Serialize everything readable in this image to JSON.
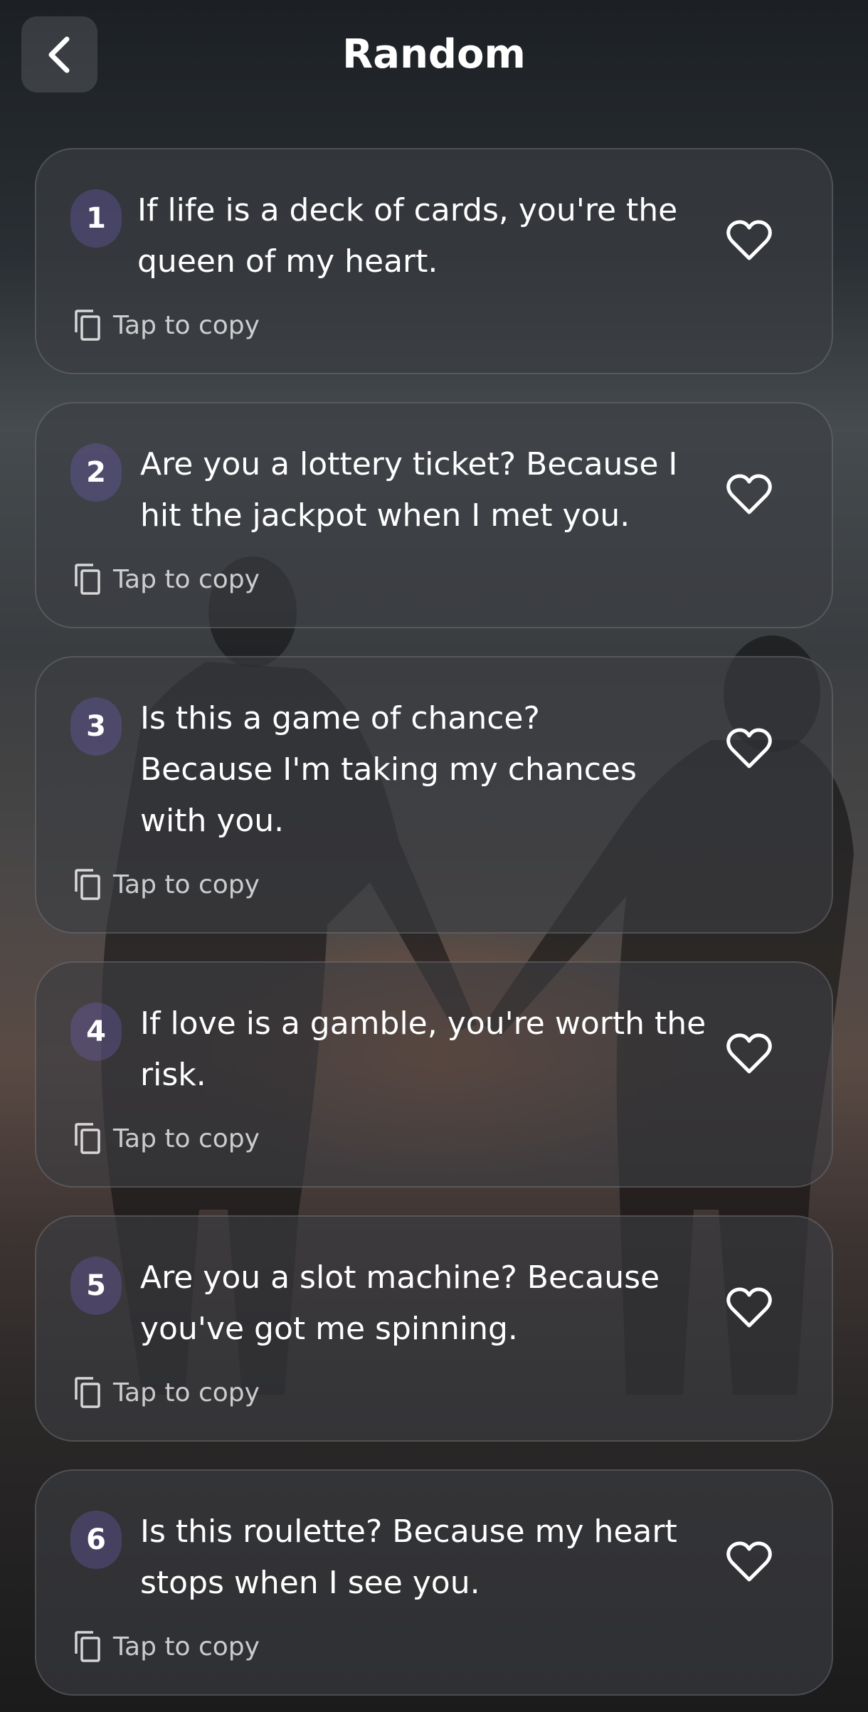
{
  "header": {
    "title": "Random",
    "back_icon": "chevron-left-icon"
  },
  "colors": {
    "card_background": "#3c3e42",
    "number_badge": "#6a5ac8",
    "text": "#ffffff",
    "muted_text": "#c0c0c0"
  },
  "items": [
    {
      "number": "1",
      "text": "If life is a deck of cards, you're the queen of my heart.",
      "copy_label": "Tap to copy",
      "favorite_icon": "heart-outline-icon",
      "copy_icon": "copy-icon"
    },
    {
      "number": "2",
      "text": "Are you a lottery ticket? Because I hit the jackpot when I met you.",
      "copy_label": "Tap to copy",
      "favorite_icon": "heart-outline-icon",
      "copy_icon": "copy-icon"
    },
    {
      "number": "3",
      "text": "Is this a game of chance? Because I'm taking my chances with you.",
      "copy_label": "Tap to copy",
      "favorite_icon": "heart-outline-icon",
      "copy_icon": "copy-icon"
    },
    {
      "number": "4",
      "text": "If love is a gamble, you're worth the risk.",
      "copy_label": "Tap to copy",
      "favorite_icon": "heart-outline-icon",
      "copy_icon": "copy-icon"
    },
    {
      "number": "5",
      "text": "Are you a slot machine? Because you've got me spinning.",
      "copy_label": "Tap to copy",
      "favorite_icon": "heart-outline-icon",
      "copy_icon": "copy-icon"
    },
    {
      "number": "6",
      "text": "Is this roulette? Because my heart stops when I see you.",
      "copy_label": "Tap to copy",
      "favorite_icon": "heart-outline-icon",
      "copy_icon": "copy-icon"
    }
  ]
}
